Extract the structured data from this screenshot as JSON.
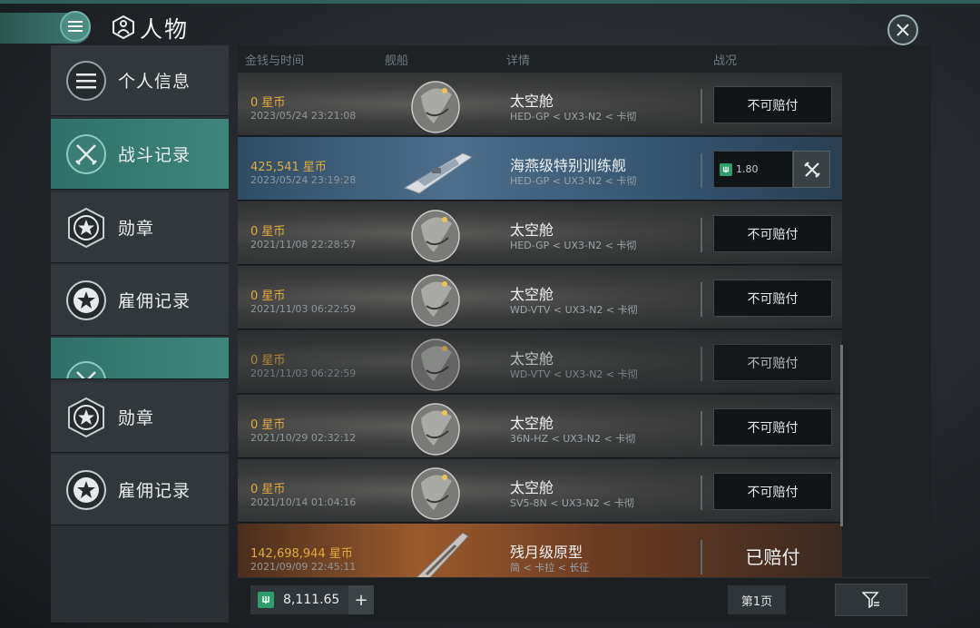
{
  "header": {
    "title": "人物"
  },
  "sidebar": {
    "items": [
      {
        "label": "个人信息",
        "icon": "menu-icon",
        "active": false
      },
      {
        "label": "战斗记录",
        "icon": "crossed-swords-icon",
        "active": true
      },
      {
        "label": "勋章",
        "icon": "star-shield-icon",
        "active": false
      },
      {
        "label": "雇佣记录",
        "icon": "star-circle-icon",
        "active": false
      },
      {
        "label": "",
        "icon": "crossed-swords-icon",
        "active": true
      },
      {
        "label": "勋章",
        "icon": "star-shield-icon",
        "active": false
      },
      {
        "label": "雇佣记录",
        "icon": "star-circle-icon",
        "active": false
      }
    ]
  },
  "columns": {
    "money_time": "金钱与时间",
    "ship": "舰船",
    "details": "详情",
    "status": "战况"
  },
  "rows": [
    {
      "money": "0 星币",
      "time": "2023/05/24  23:21:08",
      "name": "太空舱",
      "loc": "HED-GP < UX3-N2 < 卡彻",
      "status": "不可赔付",
      "ship": "capsule"
    },
    {
      "money": "425,541  星币",
      "time": "2023/05/24  23:19:28",
      "name": "海燕级特别训练舰",
      "loc": "HED-GP < UX3-N2 < 卡彻",
      "claim_value": "1.80",
      "ship": "frigate"
    },
    {
      "money": "0 星币",
      "time": "2021/11/08  22:28:57",
      "name": "太空舱",
      "loc": "HED-GP < UX3-N2 < 卡彻",
      "status": "不可赔付",
      "ship": "capsule"
    },
    {
      "money": "0 星币",
      "time": "2021/11/03  06:22:59",
      "name": "太空舱",
      "loc": "WD-VTV < UX3-N2 < 卡彻",
      "status": "不可赔付",
      "ship": "capsule"
    },
    {
      "money": "0 星币",
      "time": "2021/11/03  06:22:59",
      "name": "太空舱",
      "loc": "WD-VTV < UX3-N2 < 卡彻",
      "status": "不可赔付",
      "ship": "capsule"
    },
    {
      "money": "0 星币",
      "time": "2021/10/29  02:32:12",
      "name": "太空舱",
      "loc": "36N-HZ < UX3-N2 < 卡彻",
      "status": "不可赔付",
      "ship": "capsule"
    },
    {
      "money": "0 星币",
      "time": "2021/10/14  01:04:16",
      "name": "太空舱",
      "loc": "SV5-8N < UX3-N2 < 卡彻",
      "status": "不可赔付",
      "ship": "capsule"
    },
    {
      "money": "142,698,944  星币",
      "time": "2021/09/09  22:45:11",
      "name": "残月级原型",
      "loc": "简 < 卡拉 < 长征",
      "status_done": "已赔付",
      "ship": "cruiser"
    }
  ],
  "footer": {
    "wallet": "8,111.65",
    "plus": "+",
    "page": "第1页"
  },
  "colors": {
    "accent": "#3f857b",
    "gold": "#e3a93b",
    "plex": "#2e9c6b"
  }
}
